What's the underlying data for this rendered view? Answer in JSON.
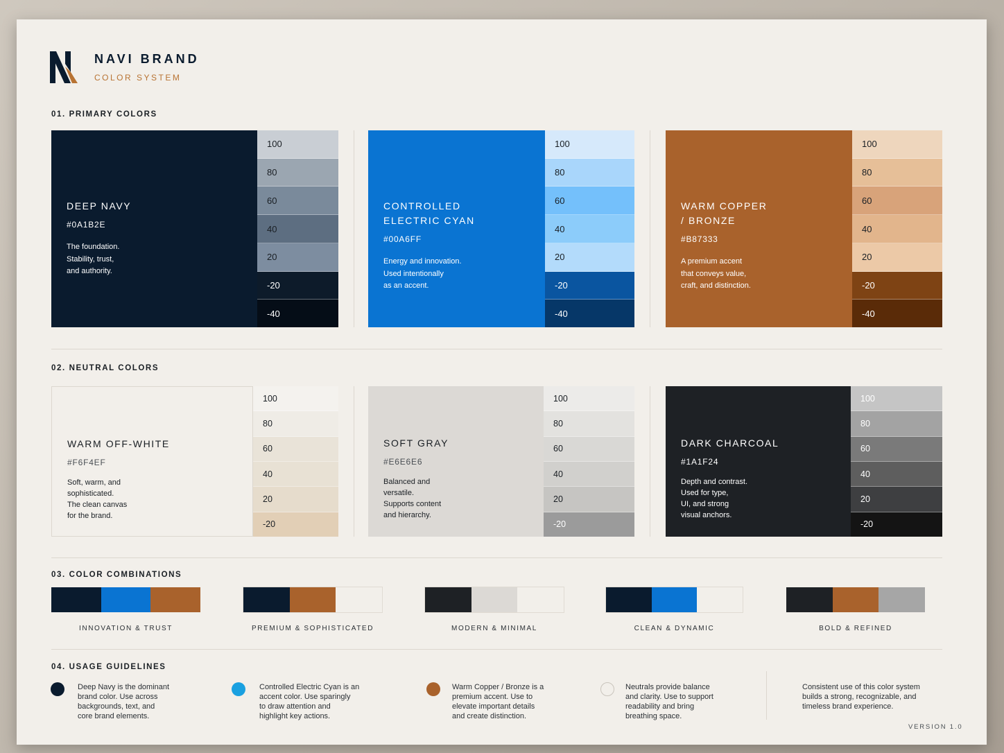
{
  "header": {
    "brand": "NAVI BRAND",
    "subtitle": "COLOR SYSTEM"
  },
  "sections": {
    "primary": "01. PRIMARY COLORS",
    "neutral": "02. NEUTRAL COLORS",
    "combinations": "03. COLOR COMBINATIONS",
    "guidelines": "04. USAGE GUIDELINES"
  },
  "primary": [
    {
      "name": "DEEP NAVY",
      "hex": "#0A1B2E",
      "desc": "The foundation.\nStability, trust,\nand authority.",
      "tints": [
        {
          "label": "100",
          "color": "#c9ced4"
        },
        {
          "label": "80",
          "color": "#9ba6b1"
        },
        {
          "label": "60",
          "color": "#7a8a9b"
        },
        {
          "label": "40",
          "color": "#5d6e81"
        },
        {
          "label": "20",
          "color": "#7d8da0"
        },
        {
          "label": "-20",
          "color": "#0d1b2a"
        },
        {
          "label": "-40",
          "color": "#050d17"
        }
      ]
    },
    {
      "name": "CONTROLLED\nELECTRIC CYAN",
      "hex": "#00A6FF",
      "desc": "Energy and innovation.\nUsed intentionally\nas an accent.",
      "tints": [
        {
          "label": "100",
          "color": "#d6e9fb"
        },
        {
          "label": "80",
          "color": "#a9d6fb"
        },
        {
          "label": "60",
          "color": "#74c0fb"
        },
        {
          "label": "40",
          "color": "#8cccfa"
        },
        {
          "label": "20",
          "color": "#b3dbfb"
        },
        {
          "label": "-20",
          "color": "#0a55a0"
        },
        {
          "label": "-40",
          "color": "#063768"
        }
      ]
    },
    {
      "name": "WARM COPPER\n/ BRONZE",
      "hex": "#B87333",
      "desc": "A premium accent\nthat conveys value,\ncraft, and distinction.",
      "tints": [
        {
          "label": "100",
          "color": "#eed6bd"
        },
        {
          "label": "80",
          "color": "#e6bf98"
        },
        {
          "label": "60",
          "color": "#d8a37a"
        },
        {
          "label": "40",
          "color": "#e2b58c"
        },
        {
          "label": "20",
          "color": "#ecc9a7"
        },
        {
          "label": "-20",
          "color": "#7e4314"
        },
        {
          "label": "-40",
          "color": "#5a2b08"
        }
      ]
    }
  ],
  "primary_colors": [
    "#0a1b2e",
    "#0a74d2",
    "#a9622c"
  ],
  "neutral": [
    {
      "name": "WARM OFF-WHITE",
      "hex": "#F6F4EF",
      "desc": "Soft, warm, and\nsophisticated.\nThe clean canvas\nfor the brand.",
      "tints": [
        {
          "label": "100",
          "color": "#f4f2ee"
        },
        {
          "label": "80",
          "color": "#efece6"
        },
        {
          "label": "60",
          "color": "#e9e3d8"
        },
        {
          "label": "40",
          "color": "#e8e1d4"
        },
        {
          "label": "20",
          "color": "#e6dccc"
        },
        {
          "label": "-20",
          "color": "#e2cfb6"
        }
      ]
    },
    {
      "name": "SOFT GRAY",
      "hex": "#E6E6E6",
      "desc": "Balanced and\nversatile.\nSupports content\nand hierarchy.",
      "tints": [
        {
          "label": "100",
          "color": "#ecebe9"
        },
        {
          "label": "80",
          "color": "#e3e2df"
        },
        {
          "label": "60",
          "color": "#d9d8d5"
        },
        {
          "label": "40",
          "color": "#d1d0cd"
        },
        {
          "label": "20",
          "color": "#c6c5c2"
        },
        {
          "label": "-20",
          "color": "#9b9b9b"
        }
      ]
    },
    {
      "name": "DARK CHARCOAL",
      "hex": "#1A1F24",
      "desc": "Depth and contrast.\nUsed for type,\nUI, and strong\nvisual anchors.",
      "tints": [
        {
          "label": "100",
          "color": "#c5c5c5"
        },
        {
          "label": "80",
          "color": "#a3a3a3"
        },
        {
          "label": "60",
          "color": "#7a7a7a"
        },
        {
          "label": "40",
          "color": "#5e5e5e"
        },
        {
          "label": "20",
          "color": "#3e3f41"
        },
        {
          "label": "-20",
          "color": "#141414"
        }
      ]
    }
  ],
  "neutral_colors": [
    "#f2efea",
    "#dcd9d5",
    "#1e2125"
  ],
  "combinations": [
    {
      "label": "INNOVATION & TRUST",
      "colors": [
        "#0a1b2e",
        "#0a74d2",
        "#a9622c"
      ]
    },
    {
      "label": "PREMIUM & SOPHISTICATED",
      "colors": [
        "#0a1b2e",
        "#a9622c",
        "#f2efea"
      ]
    },
    {
      "label": "MODERN & MINIMAL",
      "colors": [
        "#1e2125",
        "#dcd9d5",
        "#f2efea"
      ]
    },
    {
      "label": "CLEAN & DYNAMIC",
      "colors": [
        "#0a1b2e",
        "#0a74d2",
        "#f2efea"
      ]
    },
    {
      "label": "BOLD & REFINED",
      "colors": [
        "#1e2125",
        "#a9622c",
        "#a6a6a6"
      ]
    }
  ],
  "guidelines": [
    {
      "color": "#0a1b2e",
      "text": "Deep Navy is the dominant\nbrand color. Use across\nbackgrounds, text, and\ncore brand elements."
    },
    {
      "color": "#1aa0e0",
      "text": "Controlled Electric Cyan is an\naccent color. Use sparingly\nto draw attention and\nhighlight key actions."
    },
    {
      "color": "#a9622c",
      "text": "Warm Copper / Bronze is a\npremium accent. Use to\nelevate important details\nand create distinction."
    },
    {
      "color": "#f2efea",
      "text": "Neutrals provide balance\nand clarity. Use to support\nreadability and bring\nbreathing space."
    }
  ],
  "closing": "Consistent use of this color system\nbuilds a strong, recognizable, and\ntimeless brand experience.",
  "version": "VERSION 1.0"
}
